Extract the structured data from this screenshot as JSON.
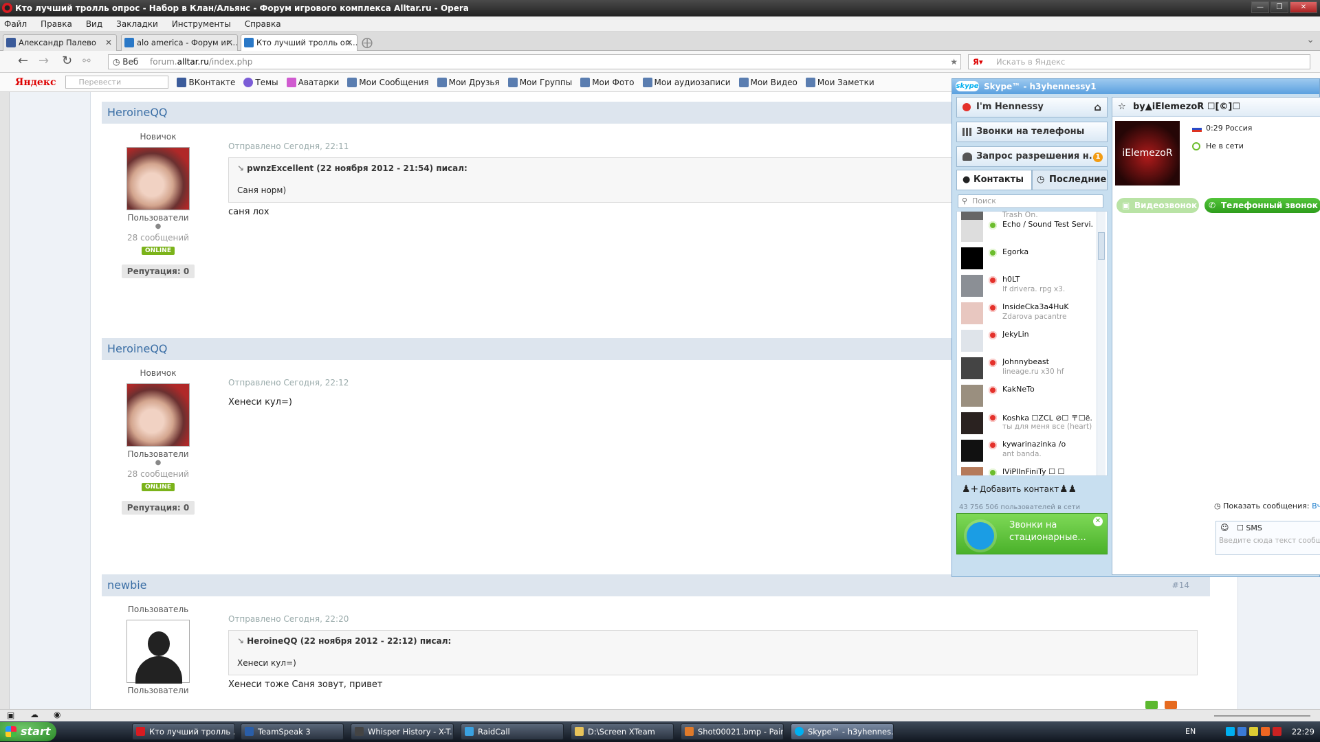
{
  "window": {
    "title": "Кто лучший тролль опрос - Набор в Клан/Альянс - Форум игрового комплекса Alltar.ru - Opera"
  },
  "menu": [
    "Файл",
    "Правка",
    "Вид",
    "Закладки",
    "Инструменты",
    "Справка"
  ],
  "tabs": [
    {
      "label": "Александр Палево",
      "color": "#3b5b9a"
    },
    {
      "label": "alo america - Форум иг...",
      "color": "#2a78c7"
    },
    {
      "label": "Кто лучший тролль оп...",
      "color": "#2a78c7"
    }
  ],
  "nav": {
    "web_label": "Веб",
    "url_prefix": "forum.",
    "url_host": "alltar.ru",
    "url_path": "/index.php",
    "search_placeholder": "Искать в Яндекс"
  },
  "yandex_bar": {
    "logo": "Яндекс",
    "translate_placeholder": "Перевести выделенное",
    "links": [
      {
        "label": "ВКонтакте",
        "color": "#3b5b9a"
      },
      {
        "label": "Темы",
        "color": "#7b5cd6"
      },
      {
        "label": "Аватарки",
        "color": "#d05bd0"
      },
      {
        "label": "Мои Сообщения",
        "color": "#5a7db0"
      },
      {
        "label": "Мои Друзья",
        "color": "#5a7db0"
      },
      {
        "label": "Мои Группы",
        "color": "#5a7db0"
      },
      {
        "label": "Мои Фото",
        "color": "#5a7db0"
      },
      {
        "label": "Мои аудиозаписи",
        "color": "#5a7db0"
      },
      {
        "label": "Мои Видео",
        "color": "#5a7db0"
      },
      {
        "label": "Мои Заметки",
        "color": "#5a7db0"
      }
    ]
  },
  "posts": [
    {
      "author": "HeroineQQ",
      "rank": "Новичок",
      "group": "Пользователи",
      "messages": "28 сообщений",
      "online": "ONLINE",
      "reputation": "Репутация: 0",
      "date": "Отправлено Сегодня, 22:11",
      "quote_header": "pwnzExcellent (22 ноября 2012 - 21:54) писал:",
      "quote_text": "Саня норм)",
      "text": "саня лох"
    },
    {
      "author": "HeroineQQ",
      "rank": "Новичок",
      "group": "Пользователи",
      "messages": "28 сообщений",
      "online": "ONLINE",
      "reputation": "Репутация: 0",
      "date": "Отправлено Сегодня, 22:12",
      "text": "Хенеси кул=)"
    },
    {
      "author": "newbie",
      "number": "#14",
      "rank": "Пользователь",
      "group": "Пользователи",
      "date": "Отправлено Сегодня, 22:20",
      "quote_header": "HeroineQQ (22 ноября 2012 - 22:12) писал:",
      "quote_text": "Хенеси кул=)",
      "text": "Хенеси тоже Саня зовут, привет"
    }
  ],
  "skype": {
    "logo": "skype",
    "title": "Skype™ - h3yhennessy1",
    "status_name": "I'm Hennessy",
    "calls_phones": "Звонки на телефоны",
    "auth_request": "Запрос разрешения н...",
    "auth_count": "1",
    "tab_contacts": "Контакты",
    "tab_recent": "Последние",
    "search_placeholder": "Поиск",
    "contacts": [
      {
        "name": "Trash On.",
        "mood": "",
        "status": "off"
      },
      {
        "name": "Echo / Sound Test Servi...",
        "mood": "",
        "status": "on"
      },
      {
        "name": "Egorka",
        "mood": "",
        "status": "on"
      },
      {
        "name": "h0LT",
        "mood": "lf drivera. rpg x3.",
        "status": "off"
      },
      {
        "name": "InsideCka3a4HuK",
        "mood": "Zdarova pacantre",
        "status": "off"
      },
      {
        "name": "JekyLin",
        "mood": "",
        "status": "off"
      },
      {
        "name": "Johnnybeast",
        "mood": "lineage.ru x30 hf",
        "status": "off"
      },
      {
        "name": "KakNeTo",
        "mood": "",
        "status": "off"
      },
      {
        "name": "Koshka ☐ZCL ⊘☐ 〒☐ё...",
        "mood": "ты для меня все (heart)",
        "status": "off"
      },
      {
        "name": "kywarinazinka /o",
        "mood": "ant banda.",
        "status": "off"
      },
      {
        "name": "lViPIInFiniTy ☐ ☐",
        "mood": "",
        "status": "on"
      }
    ],
    "add_contact": "Добавить контакт",
    "user_count": "43 756 506 пользователей в сети",
    "promo": "Звонки на стационарные...",
    "chat_name": "by▲iElemezoR ☐[©]☐",
    "chat_avatar_text": "iElemezoR",
    "chat_time": "0:29 Россия",
    "chat_status": "Не в сети",
    "video_call": "Видеозвонок",
    "phone_call": "Телефонный звонок",
    "show_messages": "Показать сообщения:",
    "show_messages_link": "Вчера",
    "sms_label": "SMS",
    "message_placeholder": "Введите сюда текст сообщения"
  },
  "taskbar": {
    "start": "start",
    "items": [
      {
        "label": "Кто лучший тролль ...",
        "color": "#d81b21"
      },
      {
        "label": "TeamSpeak 3",
        "color": "#2a5ea8"
      },
      {
        "label": "Whisper History - X-T...",
        "color": "#444"
      },
      {
        "label": "RaidCall",
        "color": "#3aa1e0"
      },
      {
        "label": "D:\\Screen XTeam",
        "color": "#e8c35a"
      },
      {
        "label": "Shot00021.bmp - Paint",
        "color": "#e07a2a"
      },
      {
        "label": "Skype™ - h3yhennes...",
        "color": "#00aff0"
      }
    ],
    "lang": "EN",
    "time": "22:29"
  }
}
